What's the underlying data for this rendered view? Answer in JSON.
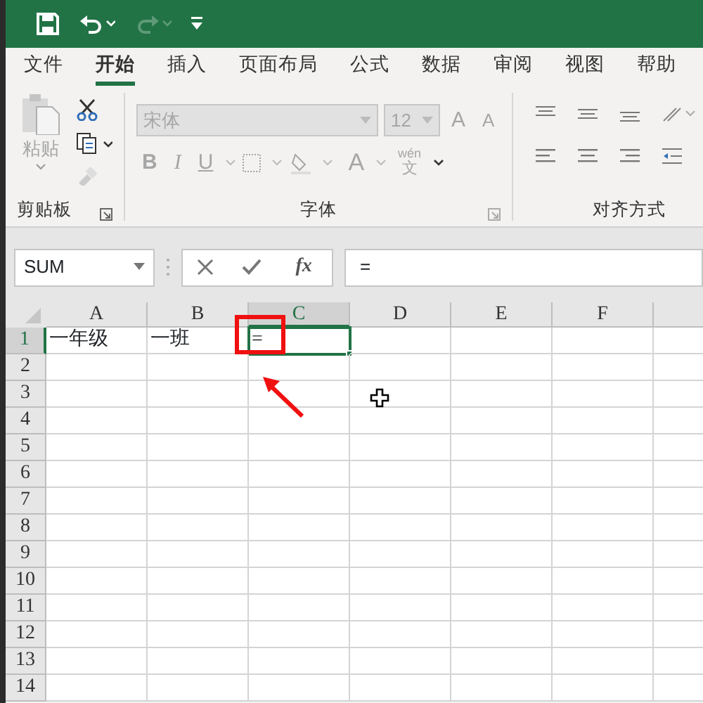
{
  "quick_access": [
    {
      "kind": "save",
      "disabled": false
    },
    {
      "kind": "undo",
      "disabled": false
    },
    {
      "kind": "redo",
      "disabled": true
    },
    {
      "kind": "customize",
      "disabled": false
    }
  ],
  "tabs": [
    {
      "label": "文件",
      "selected": false
    },
    {
      "label": "开始",
      "selected": true
    },
    {
      "label": "插入",
      "selected": false
    },
    {
      "label": "页面布局",
      "selected": false
    },
    {
      "label": "公式",
      "selected": false
    },
    {
      "label": "数据",
      "selected": false
    },
    {
      "label": "审阅",
      "selected": false
    },
    {
      "label": "视图",
      "selected": false
    },
    {
      "label": "帮助",
      "selected": false
    }
  ],
  "clipboard_group": {
    "label": "剪贴板",
    "paste_label": "粘贴",
    "disabled": true
  },
  "font_group": {
    "label": "字体",
    "disabled": true,
    "font_name": "宋体",
    "font_size": "12",
    "grow_label": "A",
    "shrink_label": "A",
    "bold_label": "B",
    "italic_label": "I",
    "underline_label": "U",
    "font_color_label": "A",
    "phonetic_top": "wén",
    "phonetic_bottom": "文"
  },
  "alignment_group": {
    "label": "对齐方式"
  },
  "name_box": "SUM",
  "formula_bar": {
    "fx_label": "fx",
    "value": "="
  },
  "columns": [
    {
      "label": "A",
      "selected": false
    },
    {
      "label": "B",
      "selected": false
    },
    {
      "label": "C",
      "selected": true
    },
    {
      "label": "D",
      "selected": false
    },
    {
      "label": "E",
      "selected": false
    },
    {
      "label": "F",
      "selected": false
    }
  ],
  "rows": [
    {
      "label": "1",
      "selected": true,
      "cells": [
        {
          "text": "一年级",
          "selected": false
        },
        {
          "text": "一班",
          "selected": false
        },
        {
          "text": "=",
          "selected": true
        }
      ]
    },
    {
      "label": "2",
      "selected": false
    },
    {
      "label": "3",
      "selected": false
    },
    {
      "label": "4",
      "selected": false
    },
    {
      "label": "5",
      "selected": false
    },
    {
      "label": "6",
      "selected": false
    },
    {
      "label": "7",
      "selected": false
    },
    {
      "label": "8",
      "selected": false
    },
    {
      "label": "9",
      "selected": false
    },
    {
      "label": "10",
      "selected": false
    },
    {
      "label": "11",
      "selected": false
    },
    {
      "label": "12",
      "selected": false
    },
    {
      "label": "13",
      "selected": false
    },
    {
      "label": "14",
      "selected": false
    }
  ]
}
